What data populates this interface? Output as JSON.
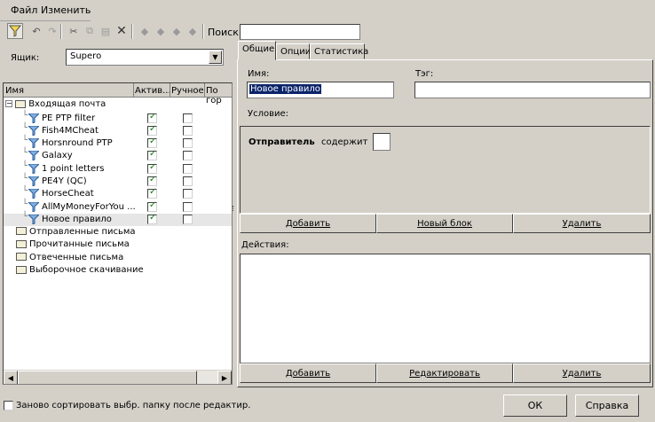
{
  "menu": {
    "file": "Файл",
    "edit": "Изменить"
  },
  "toolbar": {
    "search_label": "Поиск",
    "search_value": ""
  },
  "mailbox": {
    "label": "Ящик:",
    "value": "Supero"
  },
  "columns": [
    "Имя",
    "Актив...",
    "Ручное",
    "По гор"
  ],
  "tree": {
    "inbox": "Входящая почта",
    "rules": [
      {
        "name": "PE PTP filter",
        "active": true,
        "manual": false
      },
      {
        "name": "Fish4MCheat",
        "active": true,
        "manual": false
      },
      {
        "name": "Horsnround PTP",
        "active": true,
        "manual": false
      },
      {
        "name": "Galaxy",
        "active": true,
        "manual": false
      },
      {
        "name": "1 point letters",
        "active": true,
        "manual": false
      },
      {
        "name": "PE4Y (QC)",
        "active": true,
        "manual": false
      },
      {
        "name": "HorseCheat",
        "active": true,
        "manual": false
      },
      {
        "name": "AllMyMoneyForYou ...",
        "active": true,
        "manual": false
      },
      {
        "name": "Новое правило",
        "active": true,
        "manual": false
      }
    ],
    "folders": [
      "Отправленные письма",
      "Прочитанные письма",
      "Отвеченные письма",
      "Выборочное скачивание"
    ]
  },
  "tabs": [
    "Общие",
    "Опции",
    "Статистика"
  ],
  "general": {
    "name_label": "Имя:",
    "name_value": "Новое правило",
    "tag_label": "Тэг:",
    "tag_value": "",
    "condition_label": "Условие:",
    "sender_label": "Отправитель",
    "contains_label": "содержит",
    "cond_buttons": [
      "Добавить",
      "Новый блок",
      "Удалить"
    ],
    "actions_label": "Действия:",
    "action_buttons": [
      "Добавить",
      "Редактировать",
      "Удалить"
    ]
  },
  "footer": {
    "resort_label": "Заново сортировать выбр. папку после редактир.",
    "ok": "ОК",
    "help": "Справка"
  }
}
